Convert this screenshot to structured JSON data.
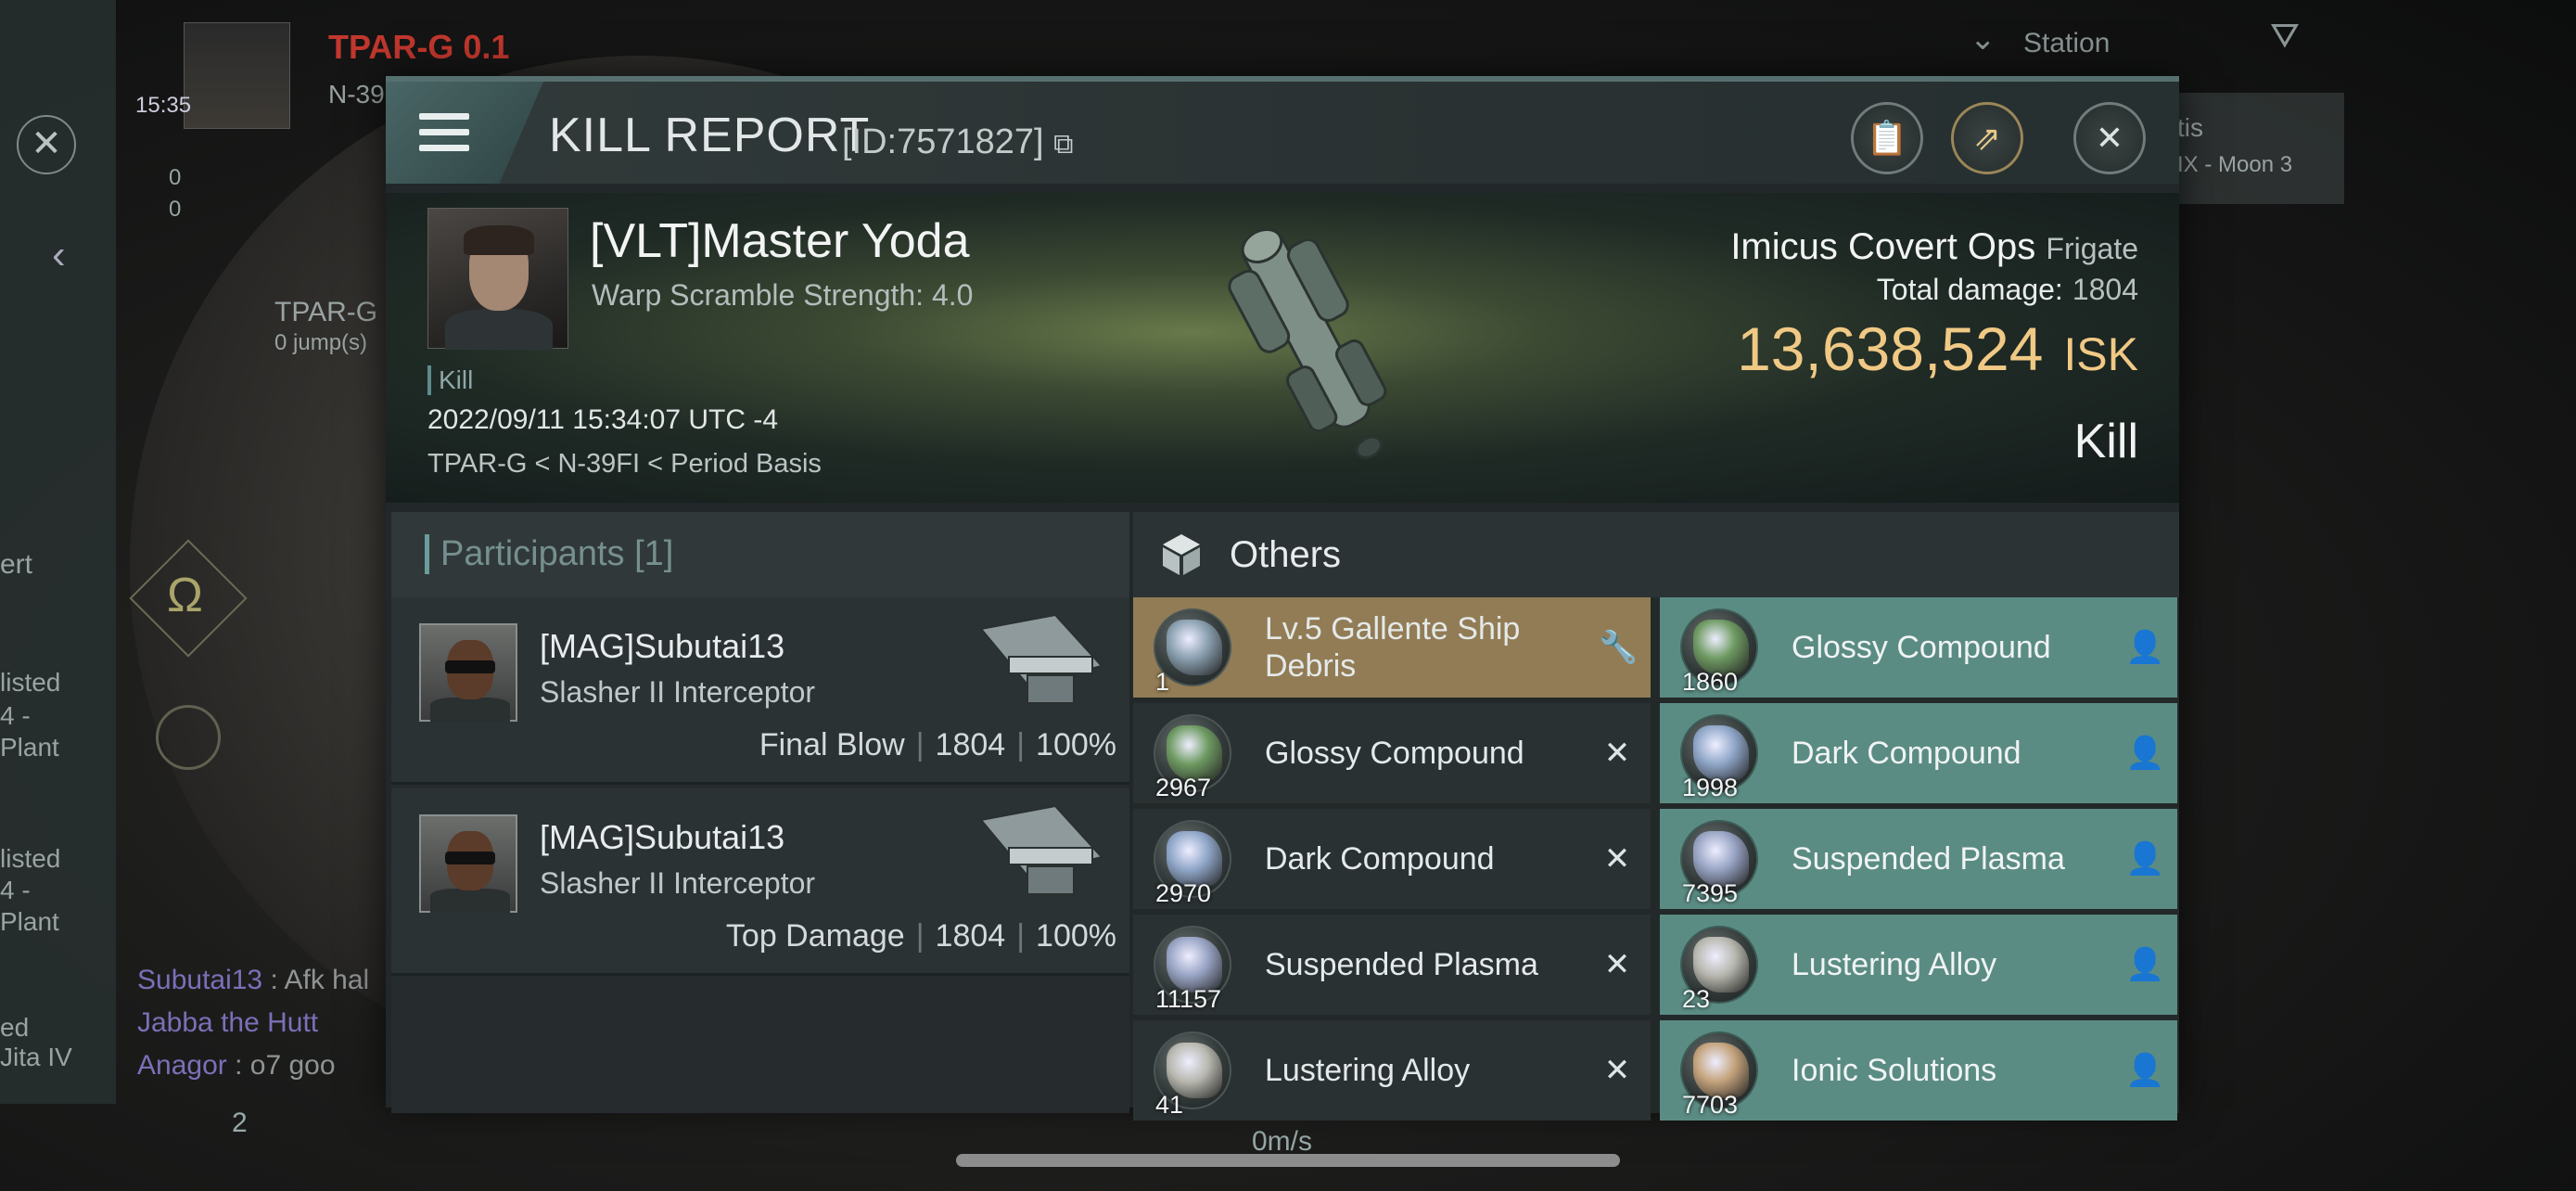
{
  "background": {
    "system_name": "TPAR-G",
    "security": "0.1",
    "system_sub": "N-39",
    "clock": "15:35",
    "standing_a": "0",
    "standing_b": "0",
    "nav_target": "TPAR-G",
    "nav_jumps": "0 jump(s)",
    "station_label": "Station",
    "right_card_a": "tis",
    "right_card_b": "IX - Moon 3",
    "speed": "0m/s",
    "people_count": "2",
    "left_snippets": [
      "ert",
      "listed",
      "4 -",
      "Plant",
      "listed",
      "4 -",
      "Plant",
      "ed",
      "Jita IV"
    ],
    "chat": [
      {
        "name": "Subutai13",
        "text": " : Afk hal"
      },
      {
        "name": "Jabba the Hutt",
        "text": ""
      },
      {
        "name": "Anagor",
        "text": " : o7 goo"
      }
    ]
  },
  "modal": {
    "title": "KILL REPORT",
    "report_id": "[ID:7571827]",
    "header_icons": [
      "clipboard-icon",
      "share-icon",
      "close-icon"
    ],
    "victim": {
      "name": "[VLT]Master Yoda",
      "sub": "Warp Scramble Strength: 4.0",
      "tag": "Kill",
      "datetime": "2022/09/11 15:34:07 UTC -4",
      "location": "TPAR-G < N-39FI < Period Basis",
      "ship_name": "Imicus Covert Ops",
      "ship_class": "Frigate",
      "damage_label": "Total damage:",
      "damage_value": "1804",
      "isk_value": "13,638,524",
      "isk_unit": "ISK",
      "result": "Kill"
    },
    "participants": {
      "header": "Participants [1]",
      "rows": [
        {
          "name": "[MAG]Subutai13",
          "ship": "Slasher II Interceptor",
          "role": "Final Blow",
          "damage": "1804",
          "percent": "100%"
        },
        {
          "name": "[MAG]Subutai13",
          "ship": "Slasher II Interceptor",
          "role": "Top Damage",
          "damage": "1804",
          "percent": "100%"
        }
      ]
    },
    "others": {
      "header": "Others",
      "left": [
        {
          "name": "Lv.5 Gallente Ship Debris",
          "qty": "1",
          "state": "wrench-icon",
          "style": "gold",
          "color": "#8aa0b0"
        },
        {
          "name": "Glossy Compound",
          "qty": "2967",
          "state": "x-icon",
          "style": "dark",
          "color": "#6e9a62"
        },
        {
          "name": "Dark Compound",
          "qty": "2970",
          "state": "x-icon",
          "style": "dark",
          "color": "#8fa6c8"
        },
        {
          "name": "Suspended Plasma",
          "qty": "11157",
          "state": "x-icon",
          "style": "dark",
          "color": "#98a4c4"
        },
        {
          "name": "Lustering Alloy",
          "qty": "41",
          "state": "x-icon",
          "style": "dark",
          "color": "#b8b8b0"
        }
      ],
      "right": [
        {
          "name": "Glossy Compound",
          "qty": "1860",
          "state": "person-icon",
          "style": "teal",
          "color": "#6e9a62"
        },
        {
          "name": "Dark Compound",
          "qty": "1998",
          "state": "person-icon",
          "style": "teal",
          "color": "#8fa6c8"
        },
        {
          "name": "Suspended Plasma",
          "qty": "7395",
          "state": "person-icon",
          "style": "teal",
          "color": "#98a4c4"
        },
        {
          "name": "Lustering Alloy",
          "qty": "23",
          "state": "person-icon",
          "style": "teal",
          "color": "#b8b8b0"
        },
        {
          "name": "Ionic Solutions",
          "qty": "7703",
          "state": "person-icon",
          "style": "teal",
          "color": "#c4a37c"
        }
      ]
    }
  }
}
